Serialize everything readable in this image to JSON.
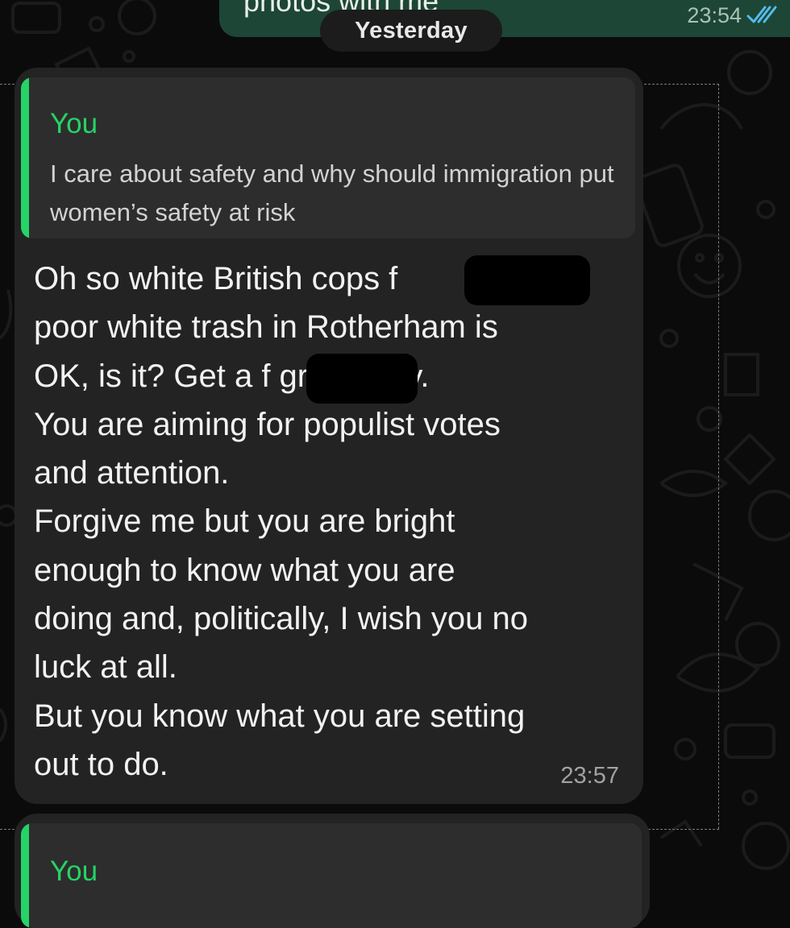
{
  "date_divider": "Yesterday",
  "previous_message": {
    "partial_text": "photos with me",
    "time": "23:54",
    "status_icon": "double-check-read-icon"
  },
  "message": {
    "reply_to": {
      "author": "You",
      "text": "I care about safety and why should immigration put women’s safety at risk"
    },
    "text": "Oh so white British cops f\npoor white trash in Rotherham is\nOK, is it? Get a f           grip Daisy.\nYou are aiming for populist votes\nand attention.\nForgive me but you are bright\nenough to know what you are\ndoing and, politically, I wish you no\nluck at all.\nBut you know what you are setting\nout to do.",
    "time": "23:57",
    "redactions": 2
  },
  "next_message": {
    "reply_to": {
      "author": "You"
    }
  },
  "colors": {
    "background": "#0b0b0b",
    "incoming_bubble": "#232323",
    "outgoing_bubble": "#1d4636",
    "quote_background": "#2d2d2d",
    "accent_green": "#25d366",
    "date_pill": "#1c1c1c",
    "redaction": "#000000"
  }
}
